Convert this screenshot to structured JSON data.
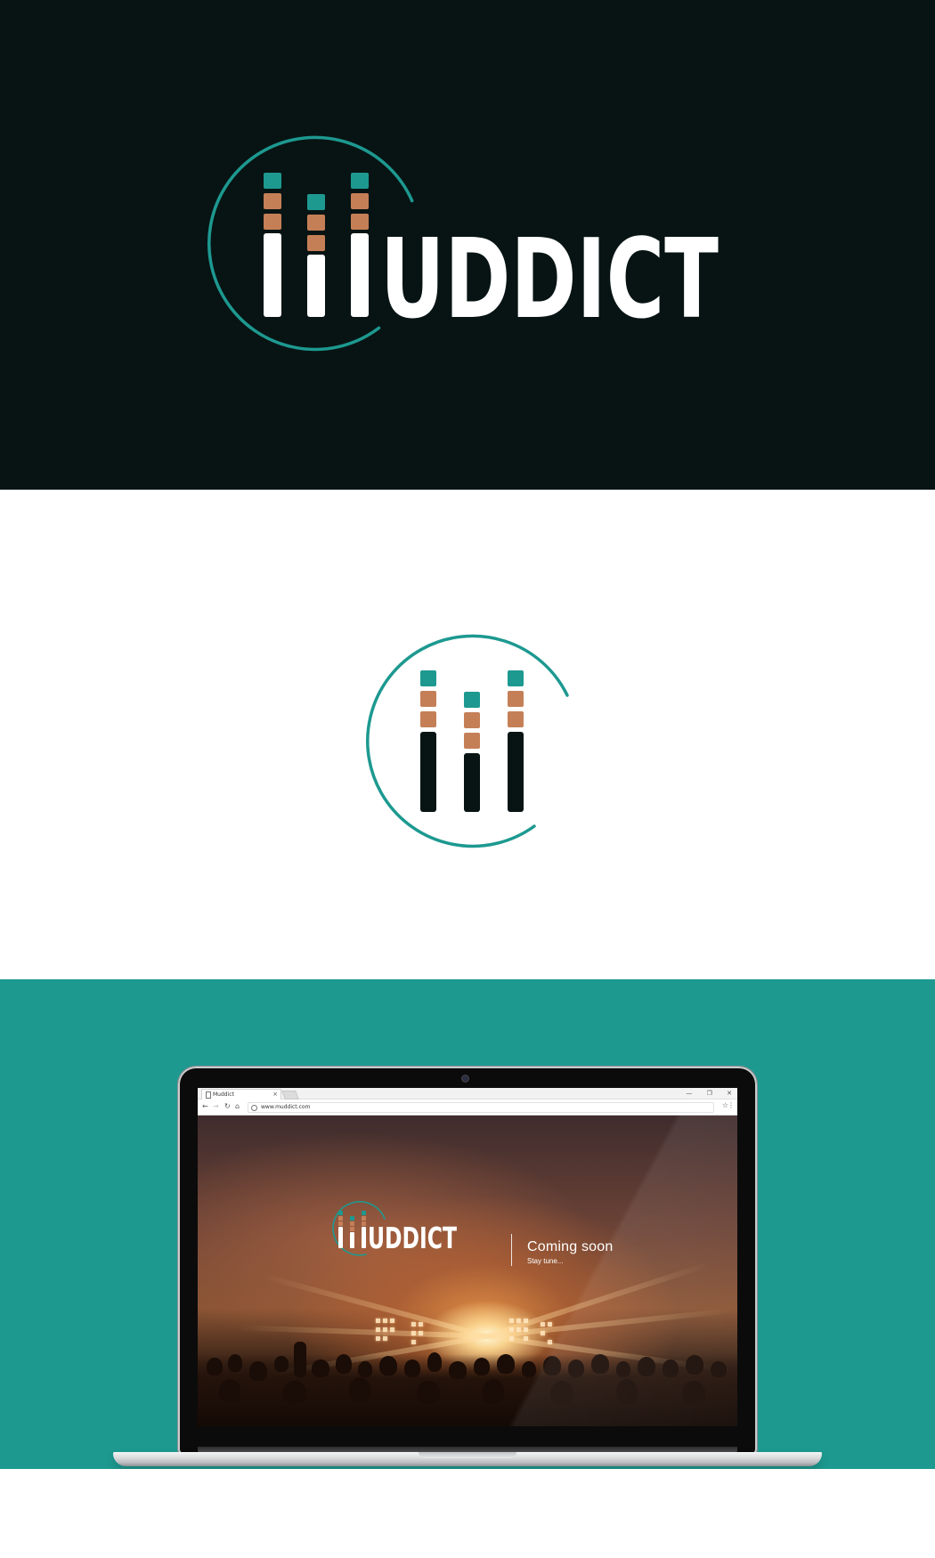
{
  "brand": {
    "wordmark": "UDDICT",
    "full_name": "MUDDICT",
    "colors": {
      "teal": "#1d9990",
      "copper": "#c57f57",
      "dark": "#081414",
      "white": "#ffffff"
    }
  },
  "mockup": {
    "browser": {
      "tab_title": "Muddict",
      "url": "www.muddict.com",
      "win_minimize": "—",
      "win_restore": "❐",
      "win_close": "✕"
    },
    "webpage": {
      "wordmark": "UDDICT",
      "headline": "Coming soon",
      "subline": "Stay tune..."
    }
  }
}
